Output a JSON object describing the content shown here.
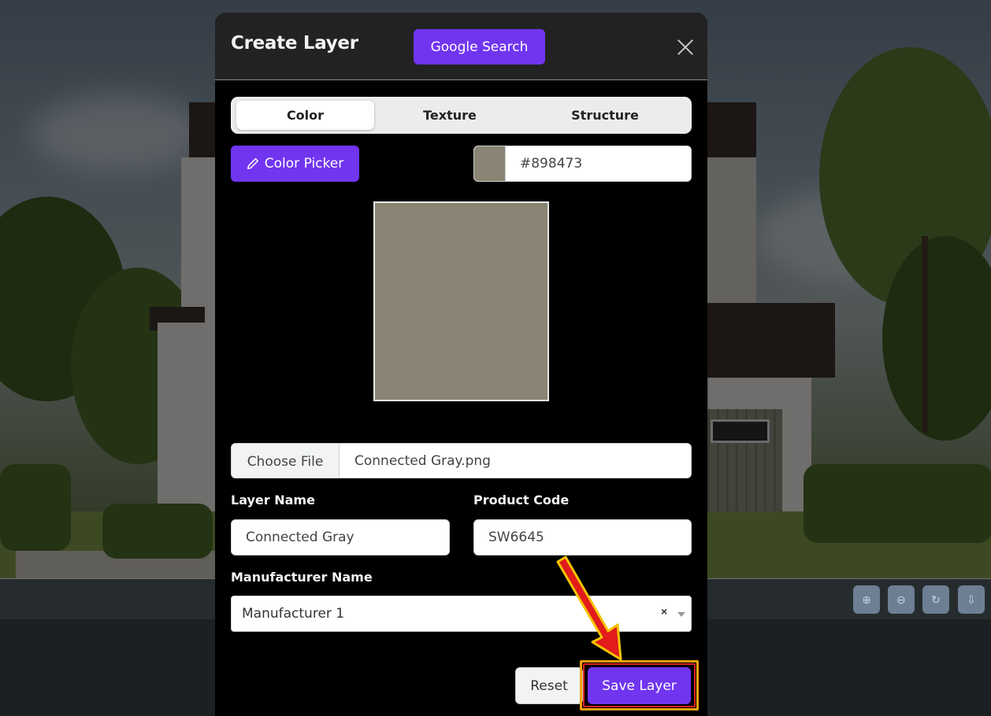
{
  "modal": {
    "title": "Create Layer",
    "google_search_label": "Google Search"
  },
  "tabs": [
    {
      "label": "Color",
      "active": true
    },
    {
      "label": "Texture",
      "active": false
    },
    {
      "label": "Structure",
      "active": false
    }
  ],
  "color": {
    "picker_label": "Color Picker",
    "hex_value": "#898473",
    "swatch_color": "#898473"
  },
  "file": {
    "button_label": "Choose File",
    "file_name": "Connected Gray.png"
  },
  "fields": {
    "layer_name_label": "Layer Name",
    "layer_name_value": "Connected Gray",
    "product_code_label": "Product Code",
    "product_code_value": "SW6645",
    "manufacturer_label": "Manufacturer Name",
    "manufacturer_value": "Manufacturer 1",
    "manufacturer_clear": "×"
  },
  "actions": {
    "reset_label": "Reset",
    "save_label": "Save Layer"
  },
  "colors": {
    "accent": "#7135f0",
    "highlight_outline": "#f1a10a",
    "arrow": "#e21b1b"
  }
}
